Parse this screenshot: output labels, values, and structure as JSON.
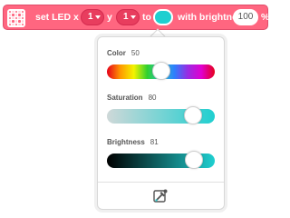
{
  "block": {
    "text_set_led": "set LED x",
    "x_value": "1",
    "text_y": "y",
    "y_value": "1",
    "text_to": "to",
    "text_with_brightness": "with brightness",
    "brightness_value": "100",
    "text_percent": "%",
    "color": "#ff6680",
    "swatch_color": "#1fcfd0"
  },
  "popup": {
    "color": {
      "label": "Color",
      "value": "50",
      "level": 0.5
    },
    "saturation": {
      "label": "Saturation",
      "value": "80",
      "level": 0.8
    },
    "brightness": {
      "label": "Brightness",
      "value": "81",
      "level": 0.81
    },
    "picker_icon": "eyedropper-icon"
  }
}
